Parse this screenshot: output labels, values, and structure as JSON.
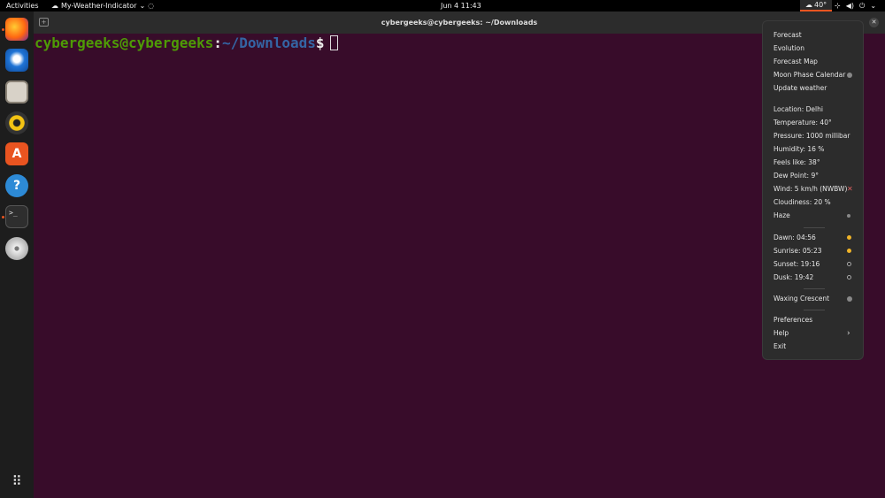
{
  "topbar": {
    "activities": "Activities",
    "app_name": "My-Weather-Indicator",
    "clock": "Jun 4  11:43",
    "weather_temp": "40°"
  },
  "terminal": {
    "title": "cybergeeks@cybergeeks: ~/Downloads",
    "prompt_user": "cybergeeks@cybergeeks",
    "prompt_colon": ":",
    "prompt_path": "~/Downloads",
    "prompt_sign": "$"
  },
  "dock": {
    "items": [
      "firefox-icon",
      "thunderbird-icon",
      "files-icon",
      "rhythmbox-icon",
      "software-icon",
      "help-icon",
      "terminal-icon",
      "dvd-icon"
    ],
    "show_apps": "show-apps-icon"
  },
  "menu": {
    "forecast": "Forecast",
    "evolution": "Evolution",
    "forecast_map": "Forecast Map",
    "moon_calendar": "Moon Phase Calendar",
    "update": "Update weather",
    "location": "Location: Delhi",
    "temperature": "Temperature: 40°",
    "pressure": "Pressure: 1000 millibar",
    "humidity": "Humidity: 16 %",
    "feels_like": "Feels like: 38°",
    "dew_point": "Dew Point: 9°",
    "wind": "Wind: 5 km/h (NWBW)",
    "cloudiness": "Cloudiness: 20 %",
    "condition": "Haze",
    "dawn": "Dawn: 04:56",
    "sunrise": "Sunrise: 05:23",
    "sunset": "Sunset: 19:16",
    "dusk": "Dusk: 19:42",
    "moon_phase": "Waxing Crescent",
    "preferences": "Preferences",
    "help": "Help",
    "exit": "Exit"
  },
  "colors": {
    "terminal_bg": "#380c2a",
    "accent": "#e95420",
    "prompt_user": "#4e9a06",
    "prompt_path": "#3465a4"
  }
}
